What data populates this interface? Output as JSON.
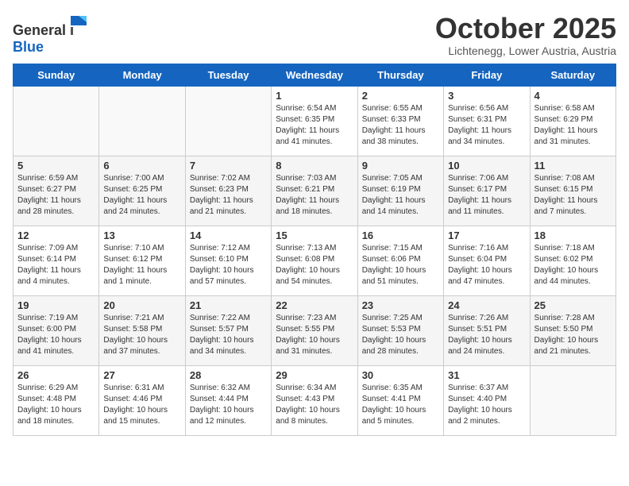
{
  "header": {
    "logo_general": "General",
    "logo_blue": "Blue",
    "month_year": "October 2025",
    "location": "Lichtenegg, Lower Austria, Austria"
  },
  "days_of_week": [
    "Sunday",
    "Monday",
    "Tuesday",
    "Wednesday",
    "Thursday",
    "Friday",
    "Saturday"
  ],
  "weeks": [
    [
      {
        "day": "",
        "content": ""
      },
      {
        "day": "",
        "content": ""
      },
      {
        "day": "",
        "content": ""
      },
      {
        "day": "1",
        "content": "Sunrise: 6:54 AM\nSunset: 6:35 PM\nDaylight: 11 hours\nand 41 minutes."
      },
      {
        "day": "2",
        "content": "Sunrise: 6:55 AM\nSunset: 6:33 PM\nDaylight: 11 hours\nand 38 minutes."
      },
      {
        "day": "3",
        "content": "Sunrise: 6:56 AM\nSunset: 6:31 PM\nDaylight: 11 hours\nand 34 minutes."
      },
      {
        "day": "4",
        "content": "Sunrise: 6:58 AM\nSunset: 6:29 PM\nDaylight: 11 hours\nand 31 minutes."
      }
    ],
    [
      {
        "day": "5",
        "content": "Sunrise: 6:59 AM\nSunset: 6:27 PM\nDaylight: 11 hours\nand 28 minutes."
      },
      {
        "day": "6",
        "content": "Sunrise: 7:00 AM\nSunset: 6:25 PM\nDaylight: 11 hours\nand 24 minutes."
      },
      {
        "day": "7",
        "content": "Sunrise: 7:02 AM\nSunset: 6:23 PM\nDaylight: 11 hours\nand 21 minutes."
      },
      {
        "day": "8",
        "content": "Sunrise: 7:03 AM\nSunset: 6:21 PM\nDaylight: 11 hours\nand 18 minutes."
      },
      {
        "day": "9",
        "content": "Sunrise: 7:05 AM\nSunset: 6:19 PM\nDaylight: 11 hours\nand 14 minutes."
      },
      {
        "day": "10",
        "content": "Sunrise: 7:06 AM\nSunset: 6:17 PM\nDaylight: 11 hours\nand 11 minutes."
      },
      {
        "day": "11",
        "content": "Sunrise: 7:08 AM\nSunset: 6:15 PM\nDaylight: 11 hours\nand 7 minutes."
      }
    ],
    [
      {
        "day": "12",
        "content": "Sunrise: 7:09 AM\nSunset: 6:14 PM\nDaylight: 11 hours\nand 4 minutes."
      },
      {
        "day": "13",
        "content": "Sunrise: 7:10 AM\nSunset: 6:12 PM\nDaylight: 11 hours\nand 1 minute."
      },
      {
        "day": "14",
        "content": "Sunrise: 7:12 AM\nSunset: 6:10 PM\nDaylight: 10 hours\nand 57 minutes."
      },
      {
        "day": "15",
        "content": "Sunrise: 7:13 AM\nSunset: 6:08 PM\nDaylight: 10 hours\nand 54 minutes."
      },
      {
        "day": "16",
        "content": "Sunrise: 7:15 AM\nSunset: 6:06 PM\nDaylight: 10 hours\nand 51 minutes."
      },
      {
        "day": "17",
        "content": "Sunrise: 7:16 AM\nSunset: 6:04 PM\nDaylight: 10 hours\nand 47 minutes."
      },
      {
        "day": "18",
        "content": "Sunrise: 7:18 AM\nSunset: 6:02 PM\nDaylight: 10 hours\nand 44 minutes."
      }
    ],
    [
      {
        "day": "19",
        "content": "Sunrise: 7:19 AM\nSunset: 6:00 PM\nDaylight: 10 hours\nand 41 minutes."
      },
      {
        "day": "20",
        "content": "Sunrise: 7:21 AM\nSunset: 5:58 PM\nDaylight: 10 hours\nand 37 minutes."
      },
      {
        "day": "21",
        "content": "Sunrise: 7:22 AM\nSunset: 5:57 PM\nDaylight: 10 hours\nand 34 minutes."
      },
      {
        "day": "22",
        "content": "Sunrise: 7:23 AM\nSunset: 5:55 PM\nDaylight: 10 hours\nand 31 minutes."
      },
      {
        "day": "23",
        "content": "Sunrise: 7:25 AM\nSunset: 5:53 PM\nDaylight: 10 hours\nand 28 minutes."
      },
      {
        "day": "24",
        "content": "Sunrise: 7:26 AM\nSunset: 5:51 PM\nDaylight: 10 hours\nand 24 minutes."
      },
      {
        "day": "25",
        "content": "Sunrise: 7:28 AM\nSunset: 5:50 PM\nDaylight: 10 hours\nand 21 minutes."
      }
    ],
    [
      {
        "day": "26",
        "content": "Sunrise: 6:29 AM\nSunset: 4:48 PM\nDaylight: 10 hours\nand 18 minutes."
      },
      {
        "day": "27",
        "content": "Sunrise: 6:31 AM\nSunset: 4:46 PM\nDaylight: 10 hours\nand 15 minutes."
      },
      {
        "day": "28",
        "content": "Sunrise: 6:32 AM\nSunset: 4:44 PM\nDaylight: 10 hours\nand 12 minutes."
      },
      {
        "day": "29",
        "content": "Sunrise: 6:34 AM\nSunset: 4:43 PM\nDaylight: 10 hours\nand 8 minutes."
      },
      {
        "day": "30",
        "content": "Sunrise: 6:35 AM\nSunset: 4:41 PM\nDaylight: 10 hours\nand 5 minutes."
      },
      {
        "day": "31",
        "content": "Sunrise: 6:37 AM\nSunset: 4:40 PM\nDaylight: 10 hours\nand 2 minutes."
      },
      {
        "day": "",
        "content": ""
      }
    ]
  ]
}
